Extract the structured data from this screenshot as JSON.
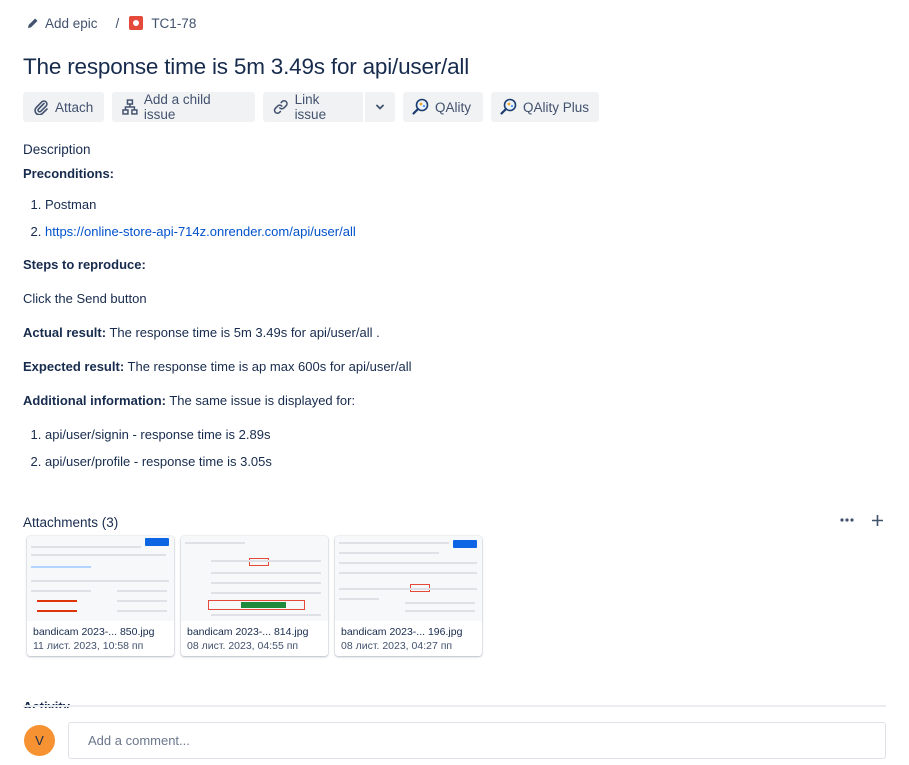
{
  "breadcrumb": {
    "epic_label": "Add epic",
    "separator": "/",
    "issue_key": "TC1-78"
  },
  "issue": {
    "title": "The response time is 5m 3.49s for api/user/all"
  },
  "toolbar": {
    "attach": "Attach",
    "child": "Add a child issue",
    "link": "Link issue",
    "qality": "QAlity",
    "qality_plus": "QAlity Plus"
  },
  "description": {
    "label": "Description",
    "preconditions_heading": "Preconditions:",
    "preconditions": [
      "Postman",
      "https://online-store-api-714z.onrender.com/api/user/all"
    ],
    "steps_heading": "Steps to reproduce:",
    "steps_text": "Click the Send button",
    "actual_label": "Actual result:",
    "actual_text": " The response time is 5m 3.49s for api/user/all .",
    "expected_label": "Expected result:",
    "expected_text": " The response time is ap max 600s for api/user/all",
    "additional_label": "Additional information:",
    "additional_text": " The same issue is displayed for:",
    "additional_items": [
      "api/user/signin - response time is 2.89s",
      "api/user/profile - response time is 3.05s"
    ]
  },
  "attachments": {
    "heading": "Attachments (3)",
    "files": [
      {
        "name": "bandicam 2023-... 850.jpg",
        "date": "11 лист. 2023, 10:58 пп"
      },
      {
        "name": "bandicam 2023-... 814.jpg",
        "date": "08 лист. 2023, 04:55 пп"
      },
      {
        "name": "bandicam 2023-... 196.jpg",
        "date": "08 лист. 2023, 04:27 пп"
      }
    ]
  },
  "activity": {
    "heading": "Activity"
  },
  "comment": {
    "avatar_initial": "V",
    "placeholder": "Add a comment..."
  },
  "colors": {
    "link": "#0052cc",
    "avatar": "#f79232",
    "bug": "#e5493a",
    "button_bg": "#f1f2f4"
  }
}
